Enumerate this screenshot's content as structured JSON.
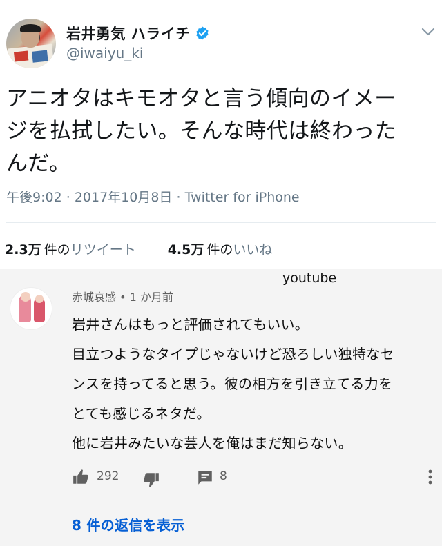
{
  "tweet": {
    "display_name": "岩井勇気 ハライチ",
    "handle": "@iwaiyu_ki",
    "text_lines": [
      "アニオタはキモオタと言う傾向のイメー",
      "ジを払拭したい。そんな時代は終わった",
      "んだ。"
    ],
    "time": "午後9:02",
    "separator": "·",
    "date": "2017年10月8日",
    "client": "Twitter for iPhone",
    "retweets": {
      "count": "2.3万",
      "unit": "件の",
      "label": "リツイート"
    },
    "likes": {
      "count": "4.5万",
      "unit": "件の",
      "label": "いいね"
    },
    "colors": {
      "verified": "#1da1f2",
      "muted": "#657786",
      "text": "#14171a"
    }
  },
  "youtube": {
    "label": "youtube",
    "author": "赤城哀感",
    "bullet": "•",
    "time_ago": "1 か月前",
    "comment_lines": [
      "岩井さんはもっと評価されてもいい。",
      "目立つようなタイプじゃないけど恐ろしい独特なセ",
      "ンスを持ってると思う。彼の相方を引き立てる力を",
      "とても感じるネタだ。",
      "他に岩井みたいな芸人を俺はまだ知らない。"
    ],
    "like_count": "292",
    "reply_count": "8",
    "view_replies": "8 件の返信を表示",
    "icons": [
      "thumbs-up-icon",
      "thumbs-down-icon",
      "comment-icon",
      "more-vertical-icon"
    ],
    "colors": {
      "link": "#065fd4",
      "background": "#f4f4f4"
    }
  }
}
